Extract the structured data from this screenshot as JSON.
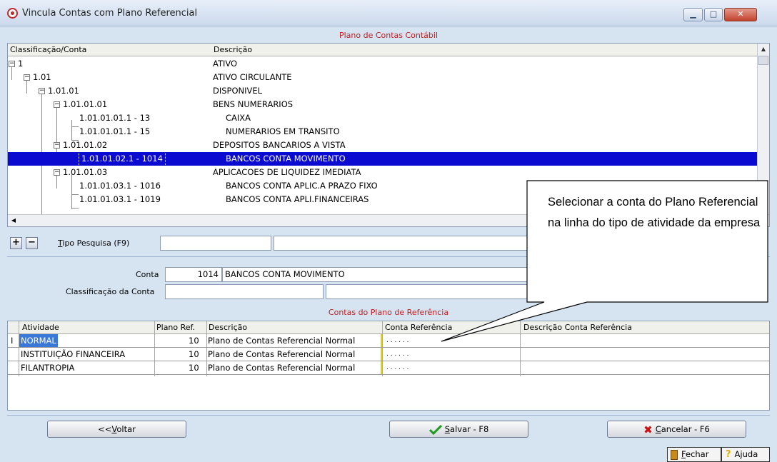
{
  "window": {
    "title": "Vincula Contas com Plano Referencial",
    "minimize_label": "▁",
    "maximize_label": "□",
    "close_label": "✕"
  },
  "tree": {
    "section_title": "Plano de Contas Contábil",
    "columns": [
      "Classificação/Conta",
      "Descrição"
    ],
    "rows": [
      {
        "account": "1",
        "description": "ATIVO",
        "expand": "−"
      },
      {
        "account": "1.01",
        "description": "ATIVO CIRCULANTE",
        "expand": "−"
      },
      {
        "account": "1.01.01",
        "description": "DISPONIVEL",
        "expand": "−"
      },
      {
        "account": "1.01.01.01",
        "description": "BENS NUMERARIOS",
        "expand": "−"
      },
      {
        "account": "1.01.01.01.1 - 13",
        "description": "CAIXA"
      },
      {
        "account": "1.01.01.01.1 - 15",
        "description": "NUMERARIOS EM TRANSITO"
      },
      {
        "account": "1.01.01.02",
        "description": "DEPOSITOS BANCARIOS A VISTA",
        "expand": "−"
      },
      {
        "account": "1.01.01.02.1 - 1014",
        "description": "BANCOS CONTA MOVIMENTO",
        "selected": true
      },
      {
        "account": "1.01.01.03",
        "description": "APLICACOES DE LIQUIDEZ IMEDIATA",
        "expand": "−"
      },
      {
        "account": "1.01.01.03.1 - 1016",
        "description": "BANCOS CONTA APLIC.A PRAZO FIXO"
      },
      {
        "account": "1.01.01.03.1 - 1019",
        "description": "BANCOS CONTA APLI.FINANCEIRAS"
      }
    ],
    "scroll_up": "▲",
    "scroll_left": "◀"
  },
  "search": {
    "add_button": "+",
    "remove_button": "−",
    "tipo_label_key": "T",
    "tipo_label_rest": "ipo Pesquisa (F9)",
    "value_1": "",
    "value_2": ""
  },
  "conta": {
    "conta_label": "Conta",
    "conta_code": "1014",
    "conta_name": "BANCOS CONTA MOVIMENTO",
    "classificacao_label": "Classificação da Conta",
    "classificacao_value_1": "",
    "classificacao_value_2": ""
  },
  "activity": {
    "section_title": "Contas do Plano de Referência",
    "columns": [
      "Atividade",
      "Plano Ref.",
      "Descrição",
      "Conta Referência",
      "Descrição Conta Referência"
    ],
    "cursor_marker": "I",
    "rows": [
      {
        "atividade": "NORMAL",
        "plano_ref": "10",
        "descricao": "Plano de Contas Referencial Normal",
        "conta_ref": ". . . . . .",
        "descricao_ref": ""
      },
      {
        "atividade": "INSTITUIÇÃO FINANCEIRA",
        "plano_ref": "10",
        "descricao": "Plano de Contas Referencial Normal",
        "conta_ref": ". . . . . .",
        "descricao_ref": ""
      },
      {
        "atividade": "FILANTROPIA",
        "plano_ref": "10",
        "descricao": "Plano de Contas Referencial Normal",
        "conta_ref": ". . . . . .",
        "descricao_ref": ""
      }
    ]
  },
  "buttons": {
    "voltar_prefix": "<<",
    "voltar_key": "V",
    "voltar_rest": "oltar",
    "salvar_key": "S",
    "salvar_rest": "alvar - F8",
    "cancelar_key": "C",
    "cancelar_rest": "ancelar - F6",
    "fechar_key": "F",
    "fechar_rest": "echar",
    "ajuda_label": "Ajuda",
    "ajuda_glyph": "?"
  },
  "callout": {
    "text": "Selecionar a conta do Plano Referencial na linha do tipo de atividade da empresa"
  },
  "colors": {
    "section_title": "#c01e1e",
    "selection": "#0a0ad0",
    "active_cell": "#3a78d8",
    "marker": "#e8d000"
  }
}
